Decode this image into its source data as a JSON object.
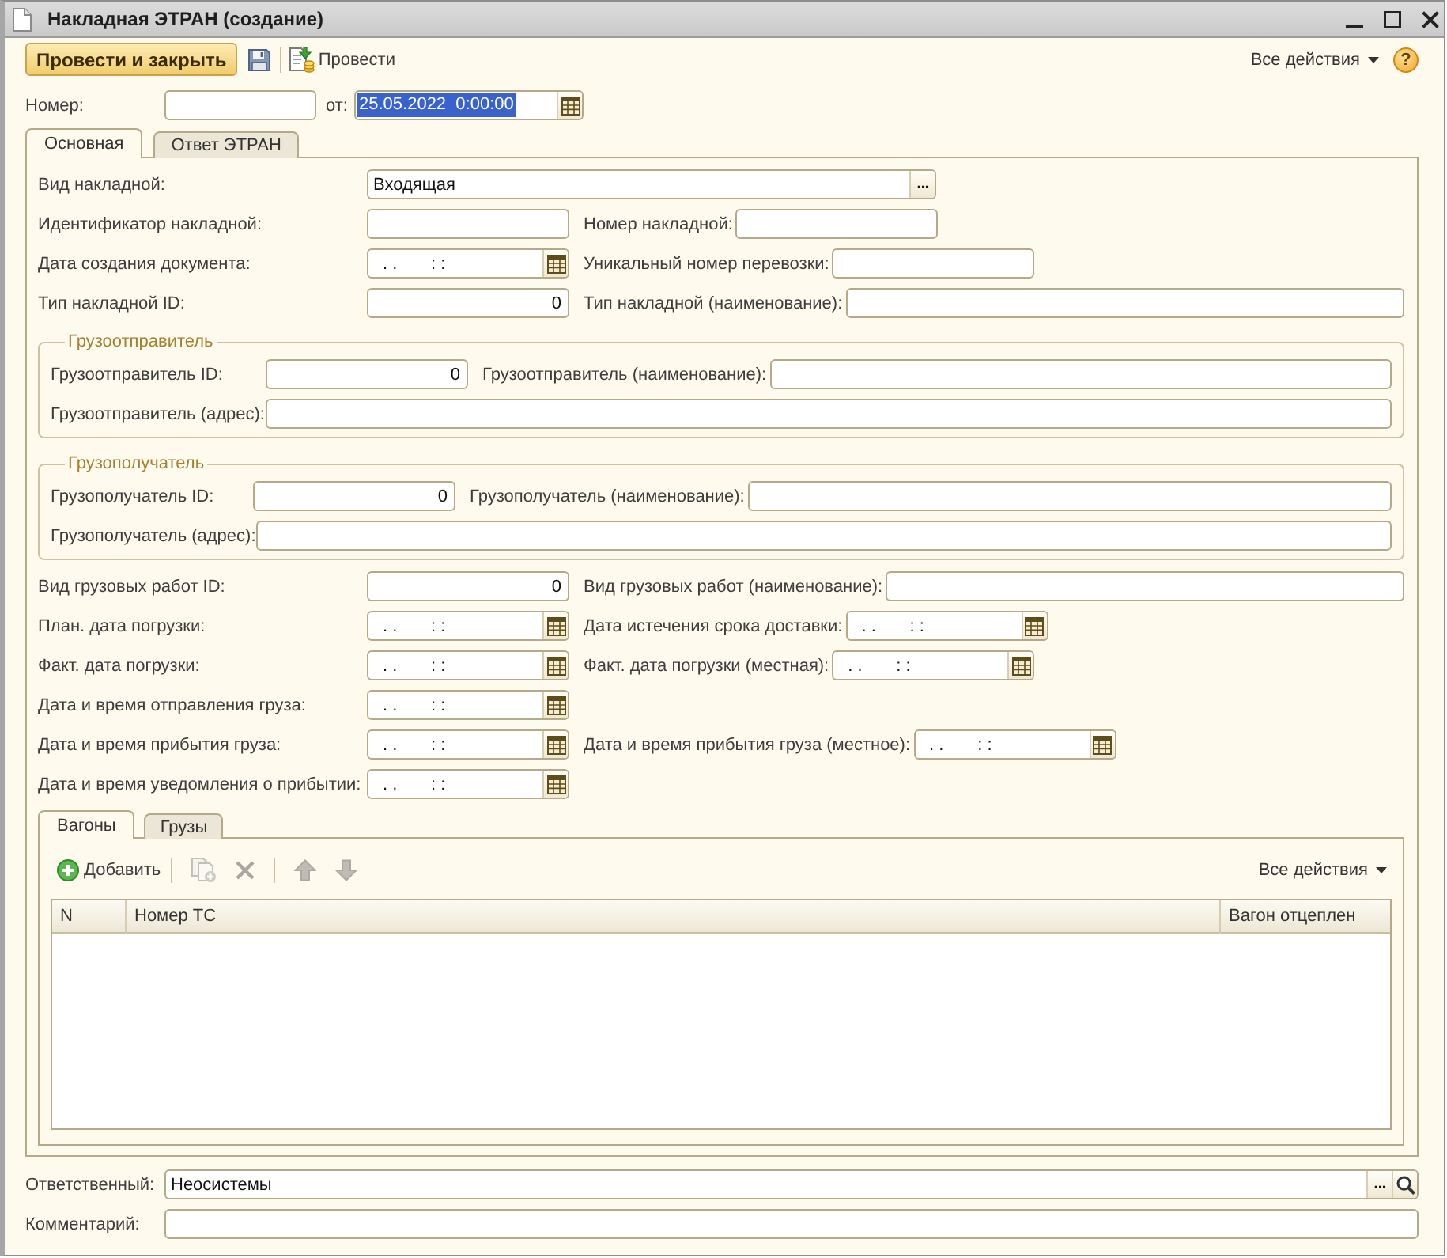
{
  "window": {
    "title": "Накладная ЭТРАН (создание)"
  },
  "toolbar": {
    "items": [
      {
        "kind": "post_close",
        "label": "Провести и закрыть"
      },
      {
        "kind": "save"
      },
      {
        "kind": "separator"
      },
      {
        "kind": "post",
        "label": "Провести"
      }
    ],
    "all_actions": "Все действия",
    "help": "?"
  },
  "header": {
    "number": {
      "label": "Номер:"
    },
    "date": {
      "label": "от:",
      "value": "25.05.2022  0:00:00",
      "selected": true
    }
  },
  "tabs": [
    {
      "label": "Основная",
      "selected": true
    },
    {
      "label": "Ответ ЭТРАН",
      "selected": false
    }
  ],
  "sections": [
    {
      "kind": "fields",
      "rows": [
        [
          {
            "label": "Вид накладной:",
            "kind": "choice",
            "value": "Входящая",
            "button": "..."
          }
        ],
        [
          {
            "label": "Идентификатор накладной:",
            "kind": "text"
          },
          {
            "label": "Номер накладной:",
            "kind": "text"
          }
        ],
        [
          {
            "label": "Дата создания документа:",
            "kind": "date",
            "value": ". .       : :"
          },
          {
            "label": "Уникальный номер перевозки:",
            "kind": "text"
          }
        ],
        [
          {
            "label": "Тип накладной ID:",
            "kind": "number",
            "value": "0"
          },
          {
            "label": "Тип накладной (наименование):",
            "kind": "text"
          }
        ]
      ]
    },
    {
      "kind": "group",
      "title": "Грузоотправитель",
      "rows": [
        [
          {
            "label": "Грузоотправитель ID:",
            "kind": "number",
            "value": "0"
          },
          {
            "label": "Грузоотправитель (наименование):",
            "kind": "text"
          }
        ],
        [
          {
            "label": "Грузоотправитель (адрес):",
            "kind": "text"
          }
        ]
      ]
    },
    {
      "kind": "group",
      "title": "Грузополучатель",
      "rows": [
        [
          {
            "label": "Грузополучатель ID:",
            "kind": "number",
            "value": "0"
          },
          {
            "label": "Грузополучатель (наименование):",
            "kind": "text"
          }
        ],
        [
          {
            "label": "Грузополучатель (адрес):",
            "kind": "text"
          }
        ]
      ]
    },
    {
      "kind": "fields",
      "rows": [
        [
          {
            "label": "Вид грузовых работ ID:",
            "kind": "number",
            "value": "0"
          },
          {
            "label": "Вид грузовых работ (наименование):",
            "kind": "text"
          }
        ],
        [
          {
            "label": "План. дата погрузки:",
            "kind": "date",
            "value": ". .       : :"
          },
          {
            "label": "Дата истечения срока доставки:",
            "kind": "date",
            "value": ". .       : :"
          }
        ],
        [
          {
            "label": "Факт. дата погрузки:",
            "kind": "date",
            "value": ". .       : :"
          },
          {
            "label": "Факт. дата погрузки (местная):",
            "kind": "date",
            "value": ". .       : :"
          }
        ],
        [
          {
            "label": "Дата и время отправления груза:",
            "kind": "date",
            "value": ". .       : :"
          }
        ],
        [
          {
            "label": "Дата и время прибытия груза:",
            "kind": "date",
            "value": ". .       : :"
          },
          {
            "label": "Дата и время прибытия груза (местное):",
            "kind": "date",
            "value": ". .       : :"
          }
        ],
        [
          {
            "label": "Дата и время уведомления о прибытии:",
            "kind": "date",
            "value": ". .       : :"
          }
        ]
      ]
    }
  ],
  "sub_tabs": [
    {
      "label": "Вагоны",
      "selected": true
    },
    {
      "label": "Грузы",
      "selected": false
    }
  ],
  "wagons": {
    "toolbar": [
      {
        "kind": "add",
        "label": "Добавить",
        "disabled": false
      },
      {
        "kind": "separator"
      },
      {
        "kind": "copy",
        "disabled": true
      },
      {
        "kind": "delete",
        "disabled": true
      },
      {
        "kind": "separator"
      },
      {
        "kind": "move_up",
        "disabled": true
      },
      {
        "kind": "move_down",
        "disabled": true
      }
    ],
    "all_actions": "Все действия",
    "columns": [
      "N",
      "Номер ТС",
      "Вагон отцеплен"
    ]
  },
  "footer": [
    {
      "label": "Ответственный:",
      "kind": "lookup",
      "value": "Неосистемы",
      "button": "..."
    },
    {
      "label": "Комментарий:",
      "kind": "text"
    }
  ]
}
